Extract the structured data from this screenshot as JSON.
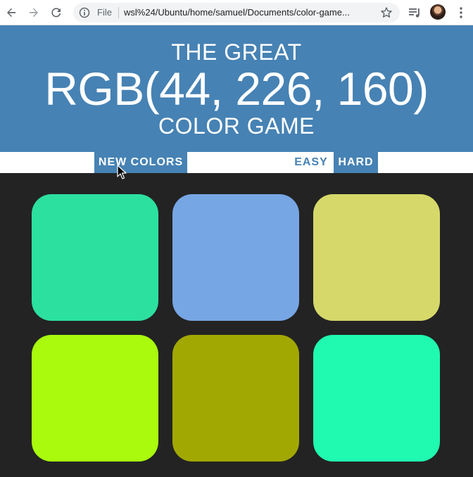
{
  "browser": {
    "file_label": "File",
    "url": "wsl%24/Ubuntu/home/samuel/Documents/color-game..."
  },
  "header": {
    "title_top": "THE GREAT",
    "rgb_display": "RGB(44, 226, 160)",
    "title_bottom": "COLOR GAME",
    "background_color": "#4682b4"
  },
  "stripe": {
    "new_colors_label": "NEW COLORS",
    "easy_label": "EASY",
    "hard_label": "HARD",
    "selected_mode": "HARD"
  },
  "squares": [
    {
      "color": "#2ce0a0"
    },
    {
      "color": "#77a6e4"
    },
    {
      "color": "#d6d86a"
    },
    {
      "color": "#a9fa0d"
    },
    {
      "color": "#a2a802"
    },
    {
      "color": "#1ffab0"
    }
  ],
  "colors": {
    "page_background": "#232323",
    "accent": "#4682b4"
  }
}
